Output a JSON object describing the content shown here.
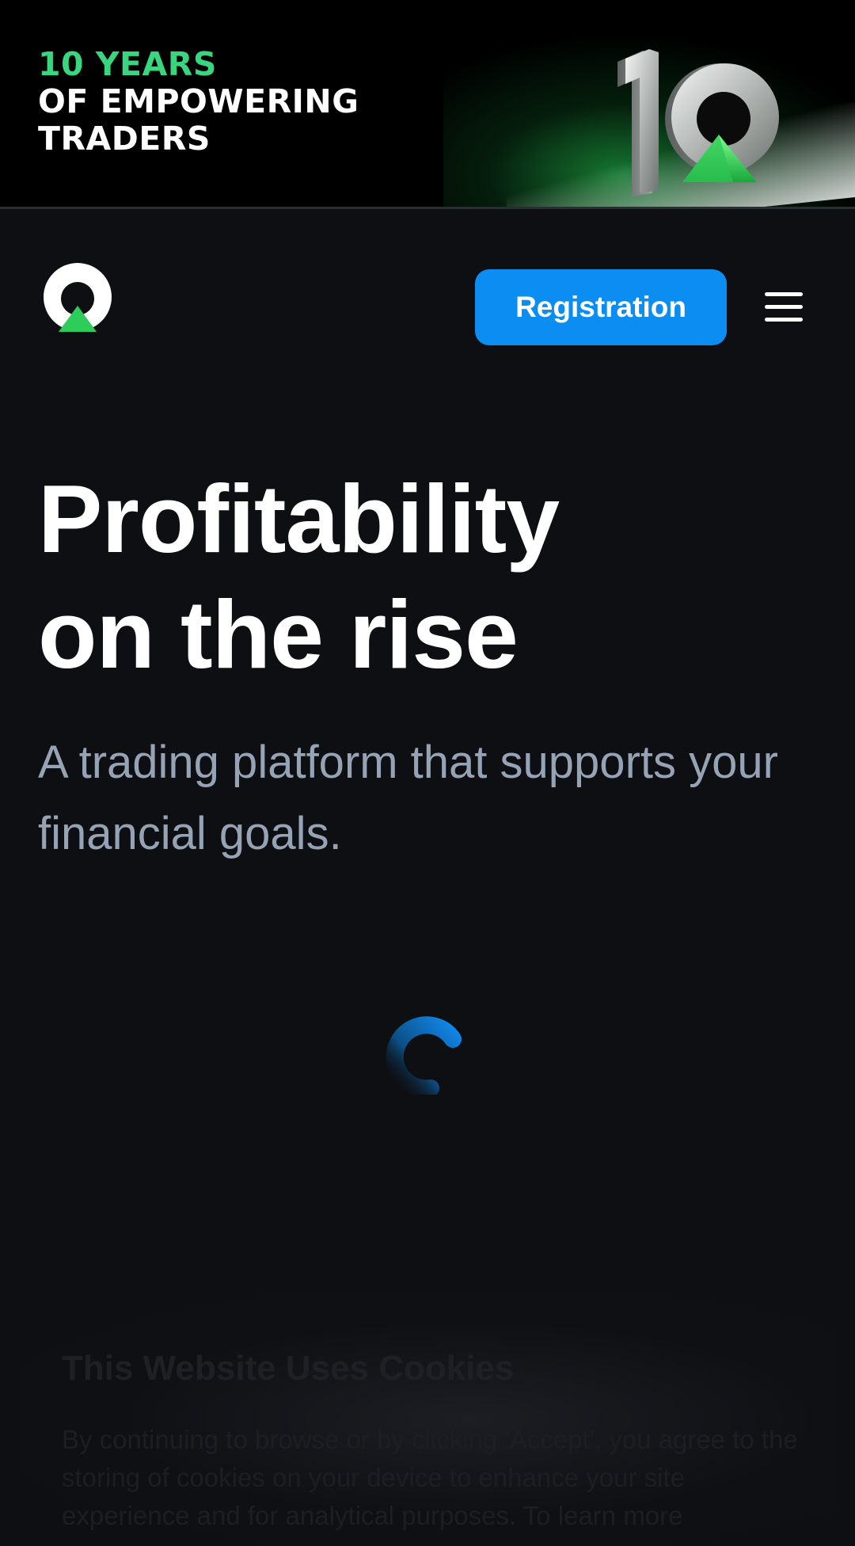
{
  "promo_banner": {
    "line1": "10 YEARS",
    "line2": "OF EMPOWERING",
    "line3": "TRADERS",
    "graphic_label": "10",
    "accent_color": "#3ad67f"
  },
  "header": {
    "logo_icon": "brand-logo-icon",
    "registration_label": "Registration",
    "menu_icon": "hamburger-menu-icon",
    "accent_color": "#0b8df2"
  },
  "hero": {
    "title_line1": "Profitability",
    "title_line2": "on the rise",
    "subtitle": "A trading platform that supports your financial goals."
  },
  "loading": {
    "icon": "loading-spinner-icon"
  },
  "cookie_banner": {
    "title": "This Website Uses Cookies",
    "text": "By continuing to browse or by clicking 'Accept', you agree to the storing of cookies on your device to enhance your site experience and for analytical purposes. To learn more"
  }
}
